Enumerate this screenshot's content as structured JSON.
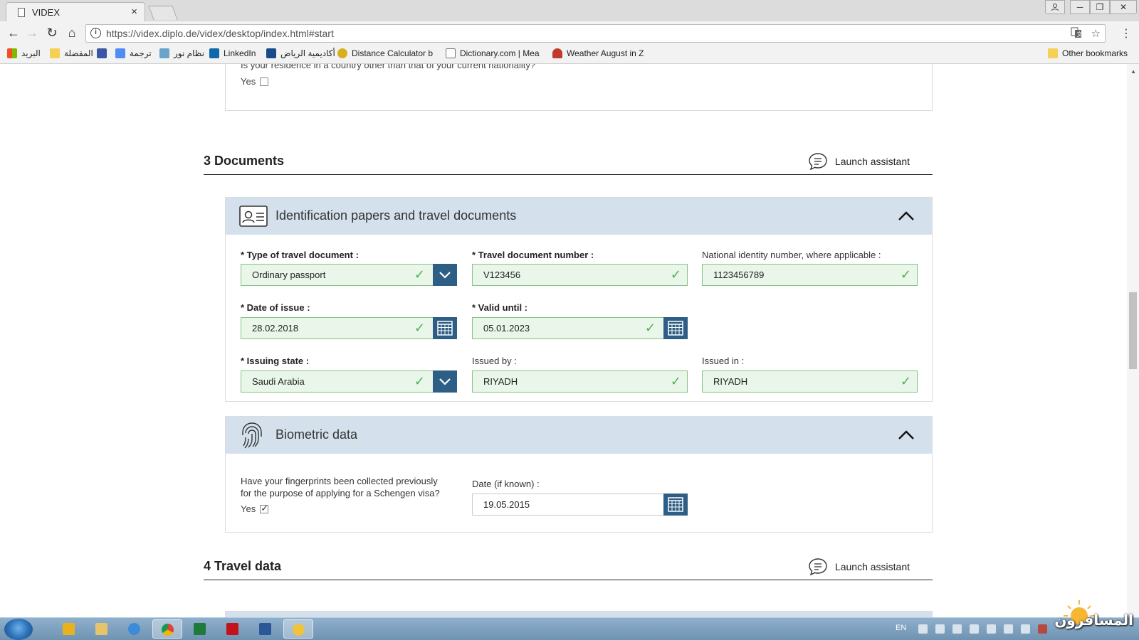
{
  "browser": {
    "tab_title": "VIDEX",
    "tab_close": "×",
    "url_host": "https://videx.diplo.de",
    "url_path": "/videx/desktop/index.html#start",
    "window_buttons": [
      "─",
      "❐",
      "✕"
    ],
    "bookmarks": [
      {
        "label": "البريد",
        "color": "#d24a3a"
      },
      {
        "label": "المفضلة",
        "color": "#f6cf55"
      },
      {
        "label": "",
        "color": "#3a57a6"
      },
      {
        "label": "ترجمة",
        "color": "#4f8cf5"
      },
      {
        "label": "نظام نور",
        "color": "#6aa5c9"
      },
      {
        "label": "LinkedIn",
        "color": "#0e6aa8"
      },
      {
        "label": "أكاديمية الرياض",
        "color": "#1b4a8a"
      },
      {
        "label": "Distance Calculator b",
        "color": "#d7b020"
      },
      {
        "label": "Dictionary.com | Mea",
        "color": "#8a8a8a"
      },
      {
        "label": "Weather August in Z",
        "color": "#c0392b"
      }
    ],
    "other_bookmarks": "Other bookmarks"
  },
  "form": {
    "residence_question": "Is your residence in a country other than that of your current nationality?",
    "residence_yes": "Yes",
    "section3": {
      "title": "3 Documents",
      "assistant": "Launch assistant",
      "id_panel": {
        "title": "Identification papers and travel documents",
        "fields": {
          "doc_type_label": "* Type of travel document :",
          "doc_type_value": "Ordinary passport",
          "doc_number_label": "* Travel document number :",
          "doc_number_value": "V123456",
          "national_id_label": "National identity number, where applicable :",
          "national_id_value": "1123456789",
          "issue_date_label": "* Date of issue :",
          "issue_date_value": "28.02.2018",
          "valid_until_label": "* Valid until :",
          "valid_until_value": "05.01.2023",
          "issuing_state_label": "* Issuing state :",
          "issuing_state_value": "Saudi Arabia",
          "issued_by_label": "Issued by :",
          "issued_by_value": "RIYADH",
          "issued_in_label": "Issued in :",
          "issued_in_value": "RIYADH"
        }
      },
      "bio_panel": {
        "title": "Biometric data",
        "question_line1": "Have your fingerprints been collected previously",
        "question_line2": "for the purpose of applying for a Schengen visa?",
        "yes_label": "Yes",
        "yes_checked": true,
        "date_label": "Date (if known) :",
        "date_value": "19.05.2015"
      }
    },
    "section4": {
      "title": "4 Travel data",
      "assistant": "Launch assistant"
    }
  },
  "taskbar": {
    "lang": "EN",
    "watermark": "المسافرون"
  }
}
